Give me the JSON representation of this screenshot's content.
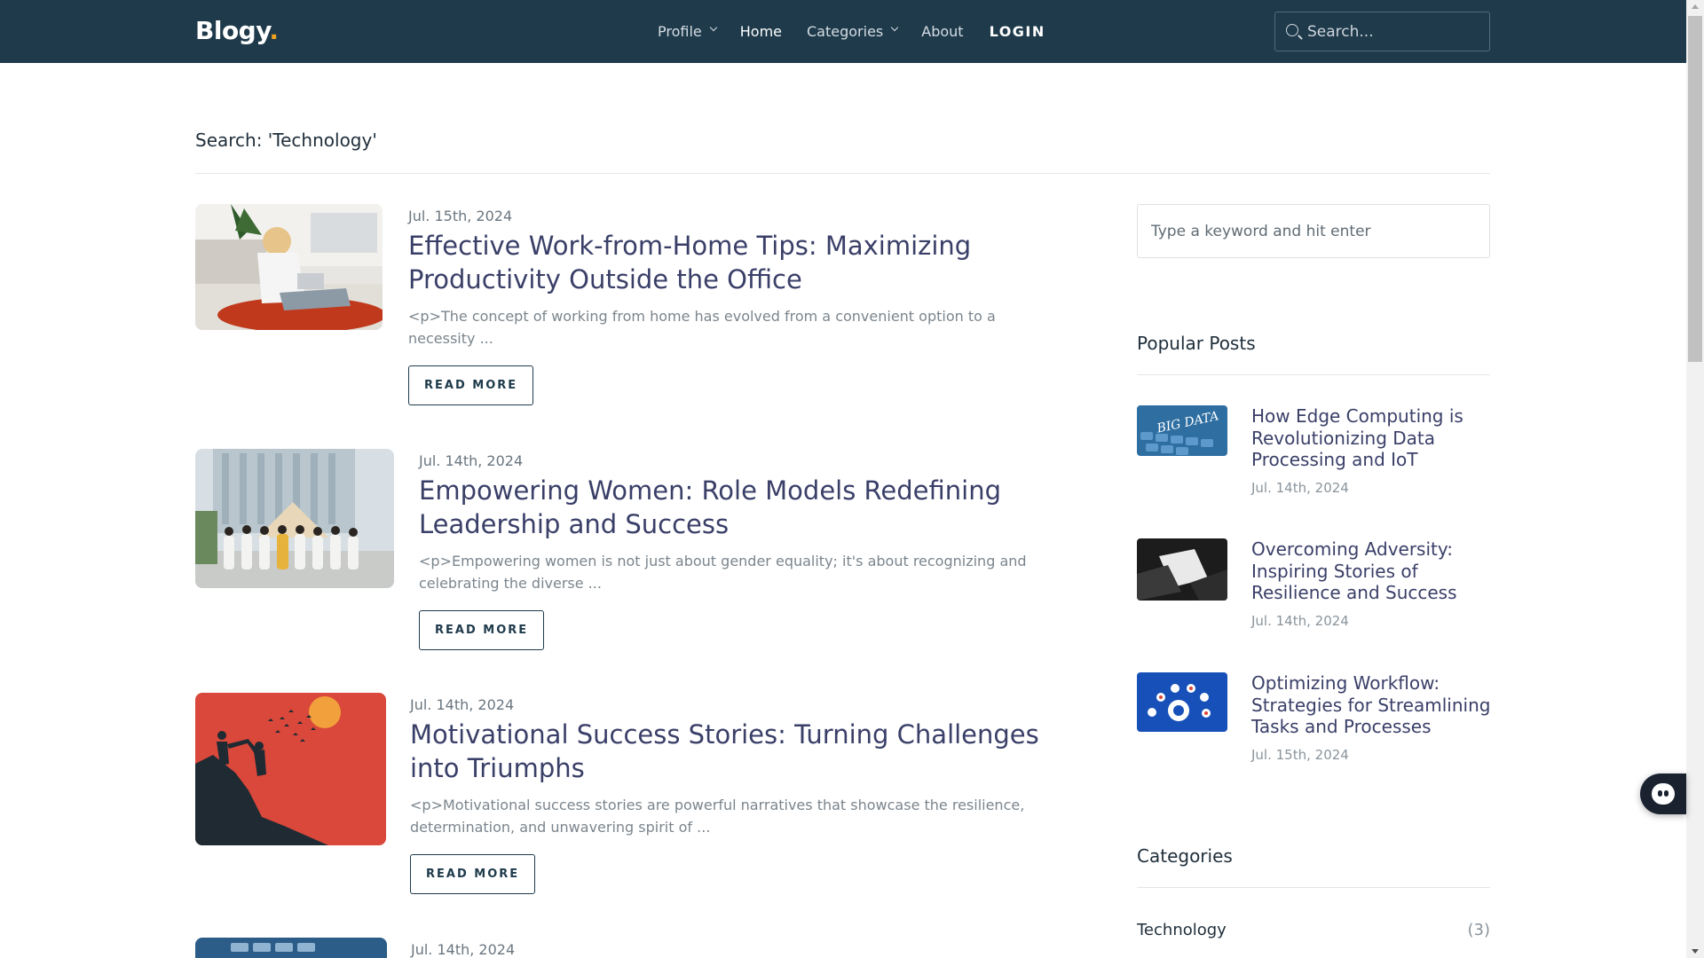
{
  "header": {
    "logo": "Blogy",
    "logo_dot": ".",
    "nav": [
      {
        "label": "Profile",
        "has_caret": true
      },
      {
        "label": "Home",
        "active": true
      },
      {
        "label": "Categories",
        "has_caret": true
      },
      {
        "label": "About"
      },
      {
        "label": "LOGIN"
      }
    ],
    "search_placeholder": "Search..."
  },
  "main": {
    "search_heading": "Search: 'Technology'",
    "posts": [
      {
        "date": "Jul. 15th, 2024",
        "title": "Effective Work-from-Home Tips: Maximizing Productivity Outside the Office",
        "excerpt": "<p>The concept of working from home has evolved from a convenient option to a necessity ...",
        "button": "READ MORE",
        "image": "woman-working-on-laptop-photo"
      },
      {
        "date": "Jul. 14th, 2024",
        "title": "Empowering Women: Role Models Redefining Leadership and Success",
        "excerpt": "<p>Empowering women is not just about gender equality; it's about recognizing and celebrating the diverse ...",
        "button": "READ MORE",
        "image": "group-of-women-photo"
      },
      {
        "date": "Jul. 14th, 2024",
        "title": "Motivational Success Stories: Turning Challenges into Triumphs",
        "excerpt": "<p>Motivational success stories are powerful narratives that showcase the resilience, determination, and unwavering spirit of ...",
        "button": "READ MORE",
        "image": "climbers-silhouette-illustration"
      },
      {
        "date": "Jul. 14th, 2024",
        "image": "keyboard-photo"
      }
    ]
  },
  "sidebar": {
    "search_placeholder": "Type a keyword and hit enter",
    "popular_title": "Popular Posts",
    "popular": [
      {
        "title": "How Edge Computing is Revolutionizing Data Processing and IoT",
        "date": "Jul. 14th, 2024",
        "image": "big-data-keyboard-photo",
        "image_text": "BIG DATA"
      },
      {
        "title": "Overcoming Adversity: Inspiring Stories of Resilience and Success",
        "date": "Jul. 14th, 2024",
        "image": "hands-holding-photo"
      },
      {
        "title": "Optimizing Workflow: Strategies for Streamlining Tasks and Processes",
        "date": "Jul. 15th, 2024",
        "image": "workflow-diagram-image"
      }
    ],
    "categories_title": "Categories",
    "categories": [
      {
        "name": "Technology",
        "count": "(3)"
      }
    ]
  },
  "colors": {
    "header_bg": "#1e3a4b",
    "title_color": "#3a3f68",
    "logo_dot": "#f0a020"
  }
}
